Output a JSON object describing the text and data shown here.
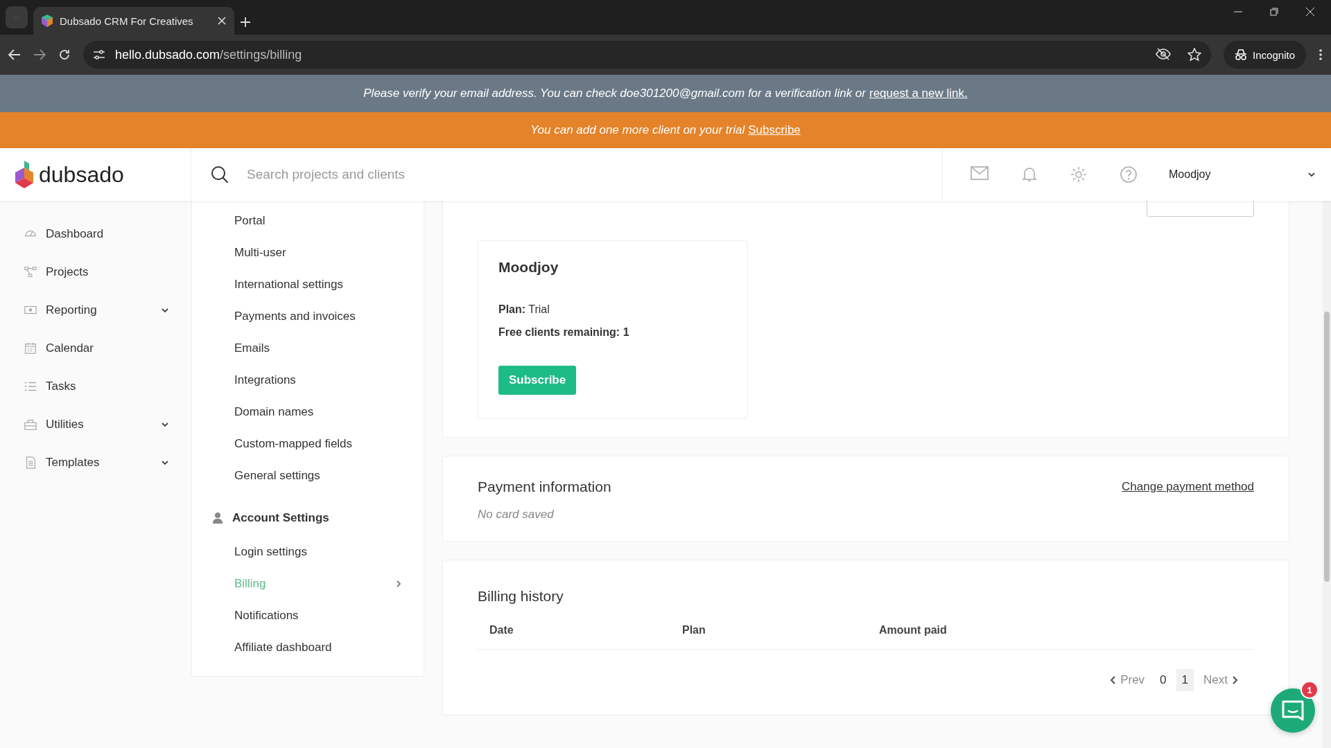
{
  "browser": {
    "tab_title": "Dubsado CRM For Creatives",
    "url_host": "hello.dubsado.com",
    "url_path": "/settings/billing",
    "incognito_label": "Incognito"
  },
  "banners": {
    "verify": {
      "text": "Please verify your email address. You can check doe301200@gmail.com for a verification link or",
      "link": "request a new link."
    },
    "trial": {
      "text": "You can add one more client on your trial",
      "link": "Subscribe"
    }
  },
  "header": {
    "logo": "dubsado",
    "search_placeholder": "Search projects and clients",
    "account": "Moodjoy"
  },
  "sidebar": [
    {
      "label": "Dashboard",
      "expandable": false
    },
    {
      "label": "Projects",
      "expandable": false
    },
    {
      "label": "Reporting",
      "expandable": true
    },
    {
      "label": "Calendar",
      "expandable": false
    },
    {
      "label": "Tasks",
      "expandable": false
    },
    {
      "label": "Utilities",
      "expandable": true
    },
    {
      "label": "Templates",
      "expandable": true
    }
  ],
  "settings_nav": [
    {
      "kind": "item",
      "label": "Portal",
      "selected": false
    },
    {
      "kind": "item",
      "label": "Multi-user",
      "selected": false
    },
    {
      "kind": "item",
      "label": "International settings",
      "selected": false
    },
    {
      "kind": "item",
      "label": "Payments and invoices",
      "selected": false
    },
    {
      "kind": "item",
      "label": "Emails",
      "selected": false
    },
    {
      "kind": "item",
      "label": "Integrations",
      "selected": false
    },
    {
      "kind": "item",
      "label": "Domain names",
      "selected": false
    },
    {
      "kind": "item",
      "label": "Custom-mapped fields",
      "selected": false
    },
    {
      "kind": "item",
      "label": "General settings",
      "selected": false
    },
    {
      "kind": "section",
      "label": "Account Settings"
    },
    {
      "kind": "item",
      "label": "Login settings",
      "selected": false
    },
    {
      "kind": "item",
      "label": "Billing",
      "selected": true
    },
    {
      "kind": "item",
      "label": "Notifications",
      "selected": false
    },
    {
      "kind": "item",
      "label": "Affiliate dashboard",
      "selected": false
    }
  ],
  "brand_card": {
    "name": "Moodjoy",
    "plan_label": "Plan:",
    "plan": "Trial",
    "clients_label": "Free clients remaining:",
    "clients": "1",
    "button": "Subscribe"
  },
  "payment": {
    "title": "Payment information",
    "link": "Change payment method",
    "empty": "No card saved"
  },
  "billing_history": {
    "title": "Billing history",
    "columns": [
      "Date",
      "Plan",
      "Amount paid"
    ],
    "pagination": [
      {
        "kind": "prev",
        "label": "Prev"
      },
      {
        "kind": "page",
        "label": "0",
        "selected": false
      },
      {
        "kind": "page",
        "label": "1",
        "selected": true
      },
      {
        "kind": "next",
        "label": "Next"
      }
    ]
  },
  "chat": {
    "badge": "1"
  }
}
